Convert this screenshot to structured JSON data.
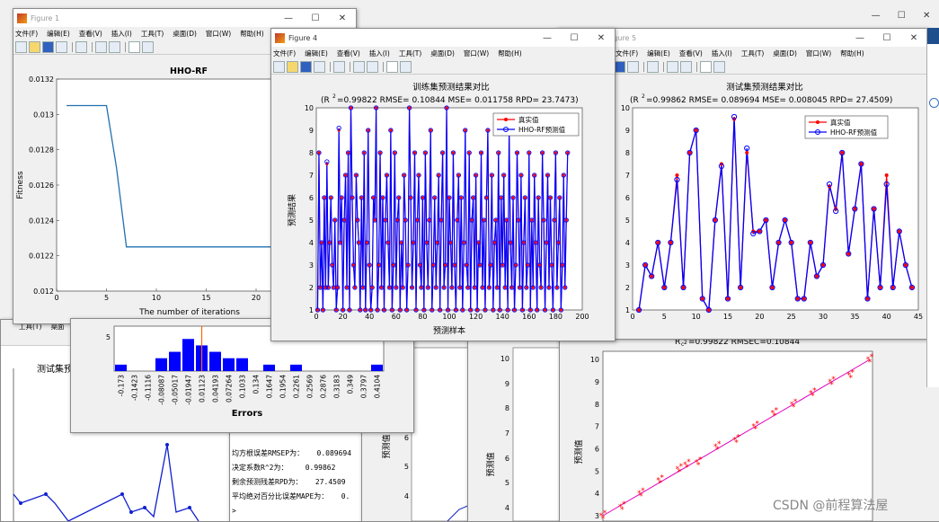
{
  "menus": [
    "文件(F)",
    "编辑(E)",
    "查看(V)",
    "插入(I)",
    "工具(T)",
    "桌面(D)",
    "窗口(W)",
    "帮助(H)"
  ],
  "fig1": {
    "title": "Figure 1",
    "plot_title": "HHO-RF",
    "ylabel": "Fitness",
    "xlabel": "The number of iterations"
  },
  "fig4": {
    "title": "Figure 4",
    "plot_title": "训练集预测结果对比",
    "subtitle": "=0.99822 RMSE= 0.10844 MSE= 0.011758 RPD= 23.7473)",
    "ylabel": "预测结果",
    "xlabel": "预测样本",
    "legend": [
      "真实值",
      "HHO-RF预测值"
    ]
  },
  "fig5": {
    "title": "Figure 5",
    "plot_title": "测试集预测结果对比",
    "subtitle": "=0.99862 RMSE= 0.089694 MSE= 0.008045 RPD= 27.4509)",
    "legend": [
      "真实值",
      "HHO-RF预测值"
    ]
  },
  "hist": {
    "xlabel": "Errors",
    "tick_labels": [
      "-0.173",
      "-0.1423",
      "-0.1116",
      "-0.08087",
      "-0.05017",
      "-0.01947",
      "0.01123",
      "0.04193",
      "0.07264",
      "0.1033",
      "0.134",
      "0.1647",
      "0.1954",
      "0.2261",
      "0.2569",
      "0.2876",
      "0.3183",
      "0.349",
      "0.3797",
      "0.4104"
    ]
  },
  "back_left": {
    "menu": [
      "工具(T)",
      "桌面"
    ],
    "title": "测试集预"
  },
  "console": {
    "lines": [
      "均方根误差RMSEP为：   0.089694",
      "决定系数R^2为：    0.99862",
      "剩余预测残差RPD为：   27.4509",
      "平均绝对百分比误差MAPE为：   0.",
      ">"
    ]
  },
  "scatter": {
    "title": "=0.99822  RMSEC=0.10844",
    "ylabel": "预测值"
  },
  "mid_plot": {
    "ylabel": "预测值"
  },
  "far_left": {
    "ylabel": "预测值"
  },
  "watermark": "CSDN @前程算法屋",
  "chart_data": [
    {
      "type": "line",
      "title": "HHO-RF",
      "xlabel": "The number of iterations",
      "ylabel": "Fitness",
      "xlim": [
        0,
        30
      ],
      "ylim": [
        0.012,
        0.0132
      ],
      "x_ticks": [
        0,
        5,
        10,
        15,
        20,
        25
      ],
      "y_ticks": [
        0.012,
        0.0122,
        0.0124,
        0.0126,
        0.0128,
        0.013,
        0.0132
      ],
      "x": [
        1,
        2,
        3,
        4,
        5,
        6,
        7,
        8,
        9,
        10,
        15,
        20,
        25,
        30
      ],
      "values": [
        0.01305,
        0.01305,
        0.01305,
        0.01305,
        0.01305,
        0.0127,
        0.01225,
        0.01225,
        0.01225,
        0.01225,
        0.01225,
        0.01225,
        0.01225,
        0.01225
      ]
    },
    {
      "type": "line",
      "title": "训练集预测结果对比",
      "xlabel": "预测样本",
      "ylabel": "预测结果",
      "xlim": [
        0,
        200
      ],
      "ylim": [
        1,
        10
      ],
      "x_ticks": [
        0,
        20,
        40,
        60,
        80,
        100,
        120,
        140,
        160,
        180,
        200
      ],
      "y_ticks": [
        1,
        2,
        3,
        4,
        5,
        6,
        7,
        8,
        9,
        10
      ],
      "series": [
        {
          "name": "真实值",
          "values": [
            1,
            8,
            2,
            4,
            1,
            6,
            2,
            7.5,
            2,
            4,
            6,
            3,
            2,
            5,
            1,
            2,
            9,
            4,
            6,
            1,
            5,
            7,
            2,
            8,
            1,
            10,
            6,
            3,
            2,
            7,
            5,
            4,
            1,
            6,
            2,
            8,
            1,
            4,
            9,
            3,
            1,
            2,
            6,
            5,
            10,
            1,
            3,
            8,
            2,
            6,
            1,
            5,
            7,
            4,
            2,
            9,
            1,
            3,
            8,
            2,
            5,
            6,
            1,
            4,
            2,
            7,
            5,
            1,
            3,
            10,
            6,
            2,
            4,
            8,
            1,
            5,
            7,
            3,
            2,
            6,
            1,
            8,
            4,
            2,
            5,
            9,
            1,
            3,
            6,
            2,
            4,
            7,
            1,
            5,
            8,
            2,
            3,
            10,
            1,
            6,
            4,
            2,
            8,
            3,
            1,
            5,
            7,
            2,
            6,
            1,
            4,
            9,
            3,
            2,
            8,
            1,
            5,
            6,
            2,
            7,
            1,
            4,
            3,
            8,
            2,
            5,
            1,
            6,
            9,
            2,
            3,
            7,
            1,
            4,
            5,
            2,
            8,
            1,
            6,
            3,
            7,
            2,
            5,
            1,
            9,
            4,
            2,
            6,
            1,
            3,
            8,
            5,
            2,
            7,
            1,
            4,
            6,
            2,
            3,
            8,
            1,
            5,
            2,
            7,
            4,
            1,
            6,
            3,
            2,
            8,
            5,
            1,
            4,
            7,
            2,
            6,
            3,
            1,
            5,
            8,
            2,
            4,
            6,
            1,
            3,
            7,
            2,
            5,
            8
          ]
        },
        {
          "name": "HHO-RF预测值",
          "values": [
            1,
            8,
            2,
            4,
            1,
            6,
            2,
            7.6,
            2,
            4,
            6,
            3,
            2,
            5,
            1,
            2,
            9.1,
            4,
            6,
            1,
            5,
            7,
            2,
            8,
            1,
            10,
            6,
            3,
            2,
            7,
            5,
            4,
            1,
            6,
            2,
            8,
            1,
            4,
            9,
            3,
            1,
            2,
            6,
            5,
            10,
            1,
            3,
            8,
            2,
            6,
            1,
            5,
            7,
            4,
            2,
            9,
            1,
            3,
            8,
            2,
            5,
            6,
            1,
            4,
            2,
            7,
            5,
            1,
            3,
            10,
            6,
            2,
            4,
            8,
            1,
            5,
            7,
            3,
            2,
            6,
            1,
            8,
            4,
            2,
            5,
            9,
            1,
            3,
            6,
            2,
            4,
            7,
            1,
            5,
            8,
            2,
            3,
            10,
            1,
            6,
            4,
            2,
            8,
            3,
            1,
            5,
            7,
            2,
            6,
            1,
            4,
            9,
            3,
            2,
            8,
            1,
            5,
            6,
            2,
            7,
            1,
            4,
            3,
            8,
            2,
            5,
            1,
            6,
            9,
            2,
            3,
            7,
            1,
            4,
            5,
            2,
            8,
            1,
            6,
            3,
            7,
            2,
            5,
            1,
            9,
            4,
            2,
            6,
            1,
            3,
            8,
            5,
            2,
            7,
            1,
            4,
            6,
            2,
            3,
            8,
            1,
            5,
            2,
            7,
            4,
            1,
            6,
            3,
            2,
            8,
            5,
            1,
            4,
            7,
            2,
            6,
            3,
            1,
            5,
            8,
            2,
            4,
            6,
            1,
            3,
            7,
            2,
            5,
            8
          ]
        }
      ]
    },
    {
      "type": "line",
      "title": "测试集预测结果对比",
      "xlim": [
        0,
        45
      ],
      "ylim": [
        1,
        10
      ],
      "x_ticks": [
        0,
        5,
        10,
        15,
        20,
        25,
        30,
        35,
        40,
        45
      ],
      "y_ticks": [
        1,
        2,
        3,
        4,
        5,
        6,
        7,
        8,
        9,
        10
      ],
      "series": [
        {
          "name": "真实值",
          "values": [
            1,
            3,
            2.5,
            4,
            2,
            4,
            7,
            2,
            8,
            9,
            1.5,
            1,
            5,
            7.5,
            1.5,
            9.5,
            2,
            8,
            4.5,
            4.5,
            5,
            2,
            4,
            5,
            4,
            1.5,
            1.5,
            4,
            2.5,
            3,
            6.5,
            5.5,
            8,
            3.5,
            5.5,
            7.5,
            1.5,
            5.5,
            2,
            7,
            2,
            4.5,
            3,
            2
          ]
        },
        {
          "name": "HHO-RF预测值",
          "values": [
            1,
            3,
            2.5,
            4,
            2,
            4,
            6.8,
            2,
            8,
            9,
            1.5,
            1,
            5,
            7.4,
            1.5,
            9.6,
            2,
            8.2,
            4.4,
            4.5,
            5,
            2,
            4,
            5,
            4,
            1.5,
            1.5,
            4,
            2.5,
            3,
            6.6,
            5.4,
            8,
            3.5,
            5.5,
            7.5,
            1.5,
            5.5,
            2,
            6.6,
            2,
            4.5,
            3,
            2
          ]
        }
      ]
    },
    {
      "type": "bar",
      "xlabel": "Errors",
      "categories": [
        "-0.173",
        "-0.1423",
        "-0.1116",
        "-0.08087",
        "-0.05017",
        "-0.01947",
        "0.01123",
        "0.04193",
        "0.07264",
        "0.1033",
        "0.134",
        "0.1647",
        "0.1954",
        "0.2261",
        "0.2569",
        "0.2876",
        "0.3183",
        "0.349",
        "0.3797",
        "0.4104"
      ],
      "values": [
        1,
        0,
        0,
        2,
        3,
        5,
        4,
        3,
        2,
        2,
        0,
        1,
        0,
        1,
        0,
        0,
        0,
        0,
        0,
        1
      ],
      "ylim": [
        0,
        7
      ],
      "y_ticks": [
        0,
        5
      ]
    },
    {
      "type": "scatter",
      "title": "=0.99822  RMSEC=0.10844",
      "ylabel": "预测值",
      "ylim": [
        3,
        10
      ],
      "y_ticks": [
        3,
        4,
        5,
        6,
        7,
        8,
        9,
        10
      ],
      "x": [
        3,
        3.5,
        4,
        4.5,
        5,
        5.2,
        5.5,
        6,
        6.5,
        7,
        7.5,
        8,
        8.5,
        9,
        9.5,
        10
      ],
      "values": [
        3,
        3.4,
        4,
        4.6,
        5.1,
        5.3,
        5.4,
        6.1,
        6.4,
        7,
        7.6,
        8,
        8.5,
        9,
        9.3,
        10
      ]
    }
  ]
}
